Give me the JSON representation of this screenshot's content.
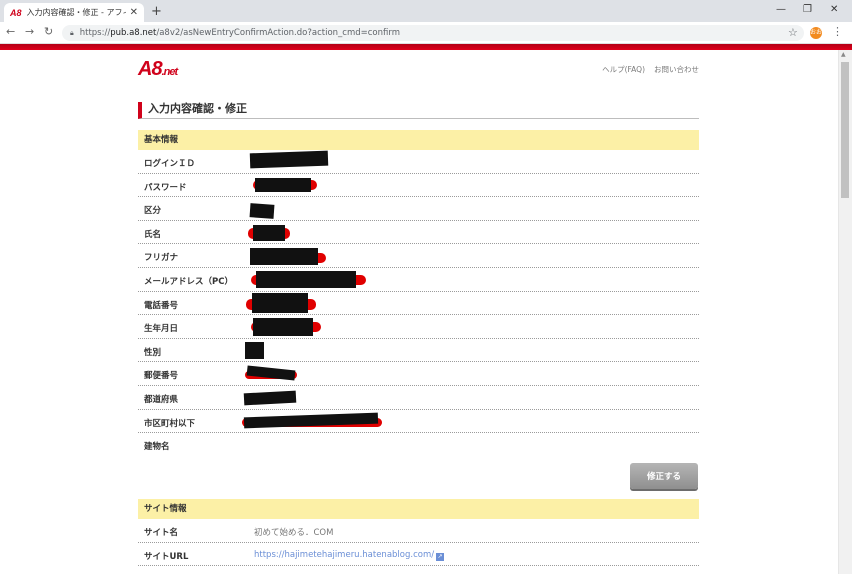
{
  "browser": {
    "tab_title": "入力内容確認・修正 - アフィリエイト",
    "tab_favicon": "A8",
    "url_scheme": "https://",
    "url_host": "pub.a8.net",
    "url_path": "/a8v2/asNewEntryConfirmAction.do?action_cmd=confirm",
    "profile_initial": "おお"
  },
  "header": {
    "logo_main": "A8",
    "logo_sub": ".net",
    "help_link": "ヘルプ(FAQ)",
    "contact_link": "お問い合わせ"
  },
  "page_title": "入力内容確認・修正",
  "basic_info": {
    "heading": "基本情報",
    "rows": [
      {
        "label": "ログインＩＤ",
        "value": ""
      },
      {
        "label": "パスワード",
        "value": ""
      },
      {
        "label": "区分",
        "value": ""
      },
      {
        "label": "氏名",
        "value": ""
      },
      {
        "label": "フリガナ",
        "value": ""
      },
      {
        "label": "メールアドレス（PC）",
        "value": ""
      },
      {
        "label": "電話番号",
        "value": ""
      },
      {
        "label": "生年月日",
        "value": ""
      },
      {
        "label": "性別",
        "value": ""
      },
      {
        "label": "郵便番号",
        "value": ""
      },
      {
        "label": "都道府県",
        "value": ""
      },
      {
        "label": "市区町村以下",
        "value": ""
      },
      {
        "label": "建物名",
        "value": ""
      }
    ],
    "fix_button": "修正する"
  },
  "site_info": {
    "heading": "サイト情報",
    "rows": [
      {
        "label": "サイト名",
        "value": "初めて始める．COM"
      },
      {
        "label": "サイトURL",
        "value": "https://hajimetehajimeru.hatenablog.com/"
      }
    ]
  },
  "colors": {
    "brand_red": "#d0021b",
    "section_yellow": "#fcf0a6",
    "link_blue": "#6b8fd6"
  },
  "icons": [
    "lock-icon",
    "star-icon",
    "external-link-icon",
    "menu-icon"
  ]
}
